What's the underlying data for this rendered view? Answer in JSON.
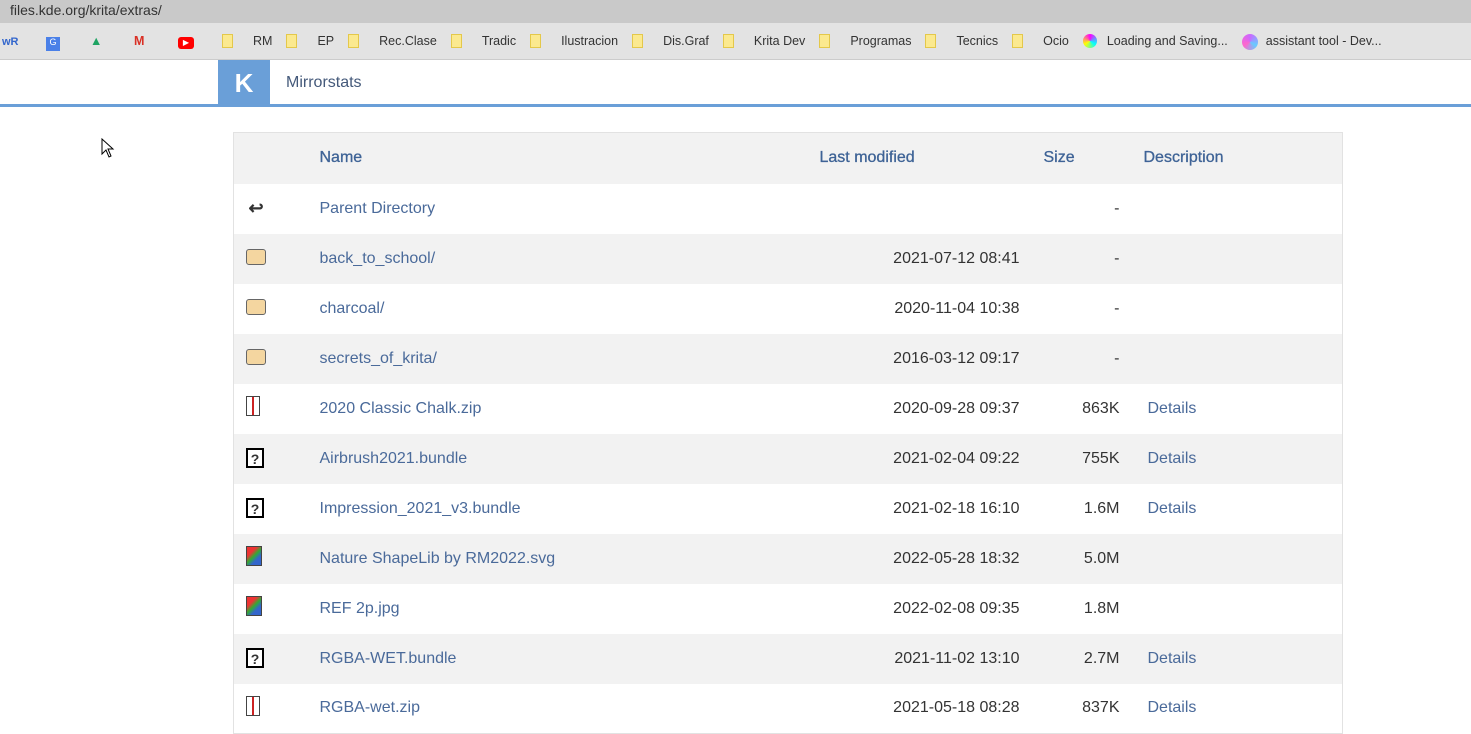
{
  "browser": {
    "url": "files.kde.org/krita/extras/",
    "bookmarks": [
      {
        "label": "",
        "icon": "wr-icon"
      },
      {
        "label": "",
        "icon": "google-translate-icon"
      },
      {
        "label": "",
        "icon": "google-drive-icon"
      },
      {
        "label": "",
        "icon": "gmail-icon"
      },
      {
        "label": "",
        "icon": "youtube-icon"
      },
      {
        "label": "RM",
        "icon": "folder"
      },
      {
        "label": "EP",
        "icon": "folder"
      },
      {
        "label": "Rec.Clase",
        "icon": "folder"
      },
      {
        "label": "Tradic",
        "icon": "folder"
      },
      {
        "label": "Ilustracion",
        "icon": "folder"
      },
      {
        "label": "Dis.Graf",
        "icon": "folder"
      },
      {
        "label": "Krita Dev",
        "icon": "folder"
      },
      {
        "label": "Programas",
        "icon": "folder"
      },
      {
        "label": "Tecnics",
        "icon": "folder"
      },
      {
        "label": "Ocio",
        "icon": "folder"
      },
      {
        "label": "Loading and Saving...",
        "icon": "krita-icon"
      },
      {
        "label": "assistant tool - Dev...",
        "icon": "krita-dev-icon"
      }
    ]
  },
  "header": {
    "logo": "K",
    "site": "Mirrorstats",
    "accent": "#6a9fd8"
  },
  "table": {
    "columns": [
      "Name",
      "Last modified",
      "Size",
      "Description"
    ],
    "rows": [
      {
        "icon": "back",
        "name": "Parent Directory",
        "date": "",
        "size": "-",
        "desc": ""
      },
      {
        "icon": "folder",
        "name": "back_to_school/",
        "date": "2021-07-12 08:41",
        "size": "-",
        "desc": ""
      },
      {
        "icon": "folder",
        "name": "charcoal/",
        "date": "2020-11-04 10:38",
        "size": "-",
        "desc": ""
      },
      {
        "icon": "folder",
        "name": "secrets_of_krita/",
        "date": "2016-03-12 09:17",
        "size": "-",
        "desc": ""
      },
      {
        "icon": "archive",
        "name": "2020 Classic Chalk.zip",
        "date": "2020-09-28 09:37",
        "size": "863K",
        "desc": "Details"
      },
      {
        "icon": "unknown",
        "name": "Airbrush2021.bundle",
        "date": "2021-02-04 09:22",
        "size": "755K",
        "desc": "Details"
      },
      {
        "icon": "unknown",
        "name": "Impression_2021_v3.bundle",
        "date": "2021-02-18 16:10",
        "size": "1.6M",
        "desc": "Details"
      },
      {
        "icon": "image",
        "name": "Nature ShapeLib by RM2022.svg",
        "date": "2022-05-28 18:32",
        "size": "5.0M",
        "desc": ""
      },
      {
        "icon": "image",
        "name": "REF 2p.jpg",
        "date": "2022-02-08 09:35",
        "size": "1.8M",
        "desc": ""
      },
      {
        "icon": "unknown",
        "name": "RGBA-WET.bundle",
        "date": "2021-11-02 13:10",
        "size": "2.7M",
        "desc": "Details"
      },
      {
        "icon": "archive",
        "name": "RGBA-wet.zip",
        "date": "2021-05-18 08:28",
        "size": "837K",
        "desc": "Details"
      }
    ]
  }
}
